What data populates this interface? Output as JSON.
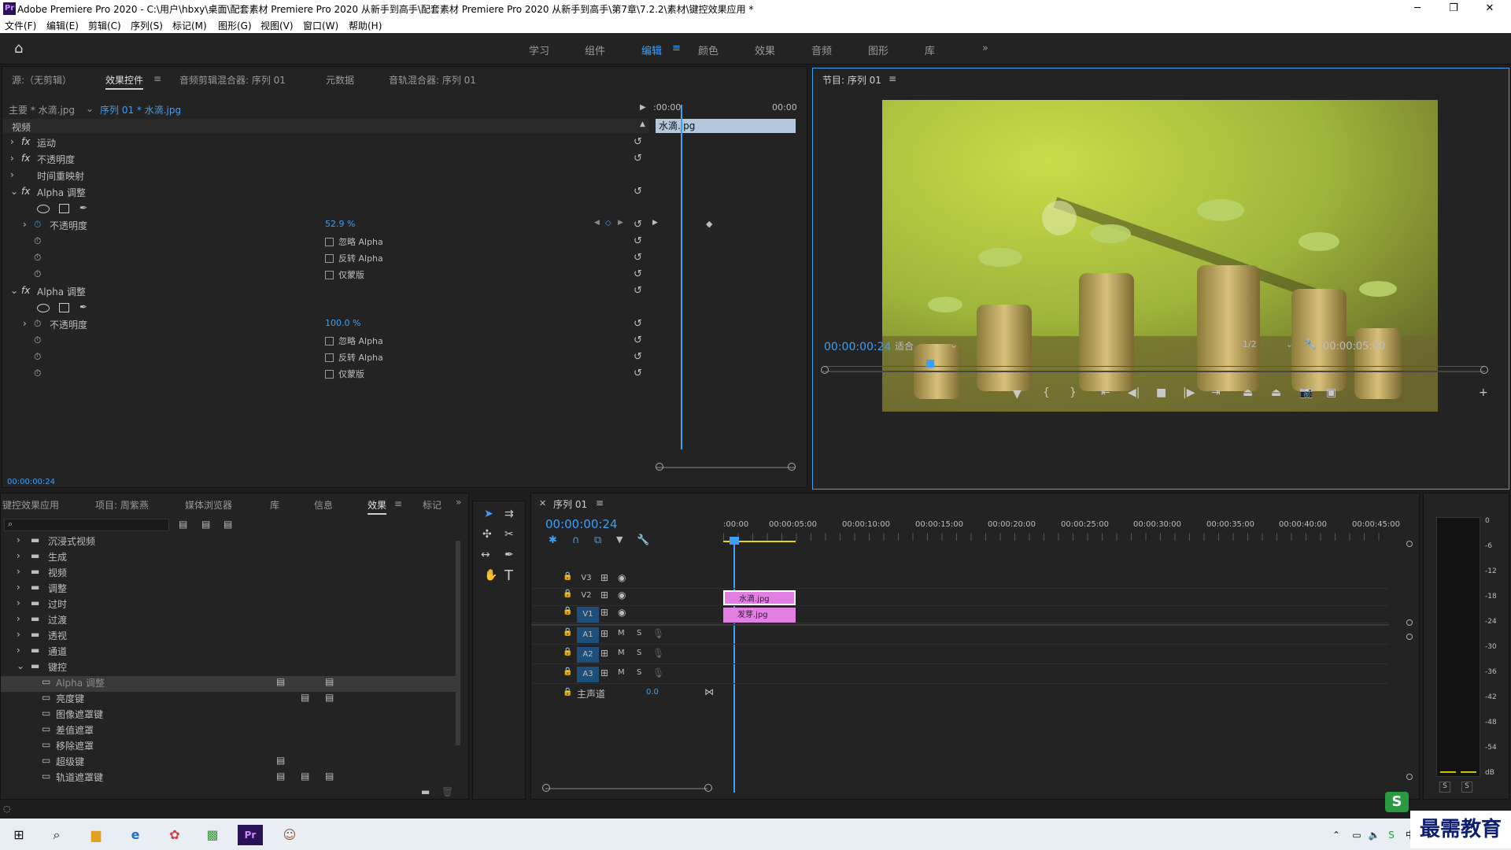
{
  "titlebar": {
    "title": "Adobe Premiere Pro 2020 - C:\\用户\\hbxy\\桌面\\配套素材 Premiere Pro 2020 从新手到高手\\配套素材 Premiere Pro 2020 从新手到高手\\第7章\\7.2.2\\素材\\键控效果应用 *",
    "minimize": "─",
    "maximize": "❐",
    "close": "✕"
  },
  "menu": [
    "文件(F)",
    "编辑(E)",
    "剪辑(C)",
    "序列(S)",
    "标记(M)",
    "图形(G)",
    "视图(V)",
    "窗口(W)",
    "帮助(H)"
  ],
  "workspaces": [
    "学习",
    "组件",
    "编辑",
    "颜色",
    "效果",
    "音频",
    "图形",
    "库"
  ],
  "workspace_more": "»",
  "effect_controls": {
    "tabs": [
      "源:（无剪辑）",
      "效果控件",
      "音频剪辑混合器: 序列 01",
      "元数据",
      "音轨混合器: 序列 01"
    ],
    "master": "主要 * 水滴.jpg",
    "sequence": "序列 01 * 水滴.jpg",
    "time_start": ":00:00",
    "time_end": "00:00",
    "clip_name": "水滴.jpg",
    "section": "视频",
    "items": [
      {
        "label": "运动",
        "fx": "fx"
      },
      {
        "label": "不透明度",
        "fx": "fx"
      },
      {
        "label": "时间重映射",
        "fx": ""
      },
      {
        "label": "Alpha 调整",
        "fx": "fx"
      }
    ],
    "alpha1": {
      "opacity_label": "不透明度",
      "opacity_value": "52.9 %",
      "ignore": "忽略 Alpha",
      "invert": "反转 Alpha",
      "mask": "仅蒙版"
    },
    "alpha2": {
      "title": "Alpha 调整",
      "opacity_label": "不透明度",
      "opacity_value": "100.0 %",
      "ignore": "忽略 Alpha",
      "invert": "反转 Alpha",
      "mask": "仅蒙版"
    },
    "current_time": "00:00:00:24"
  },
  "program": {
    "title": "节目: 序列 01",
    "timecode": "00:00:00:24",
    "fit": "适合",
    "resolution": "1/2",
    "duration": "00:00:05:00"
  },
  "project": {
    "tabs": [
      "键控效果应用",
      "项目: 周紫燕",
      "媒体浏览器",
      "库",
      "信息",
      "效果",
      "标记"
    ],
    "folders": [
      "沉浸式视频",
      "生成",
      "视频",
      "调整",
      "过时",
      "过渡",
      "透视",
      "通道",
      "键控"
    ],
    "keying": [
      "Alpha 调整",
      "亮度键",
      "图像遮罩键",
      "差值遮罩",
      "移除遮罩",
      "超级键",
      "轨道遮罩键"
    ]
  },
  "timeline": {
    "title": "序列 01",
    "timecode": "00:00:00:24",
    "ruler": [
      ":00:00",
      "00:00:05:00",
      "00:00:10:00",
      "00:00:15:00",
      "00:00:20:00",
      "00:00:25:00",
      "00:00:30:00",
      "00:00:35:00",
      "00:00:40:00",
      "00:00:45:00"
    ],
    "video_tracks": [
      "V3",
      "V2",
      "V1"
    ],
    "audio_tracks": [
      "A1",
      "A2",
      "A3"
    ],
    "master": "主声道",
    "master_value": "0.0",
    "clip_v2": "水滴.jpg",
    "clip_v1": "发芽.jpg",
    "m": "M",
    "s": "S"
  },
  "meter": {
    "scale": [
      "0",
      "-6",
      "-12",
      "-18",
      "-24",
      "-30",
      "-36",
      "-42",
      "-48",
      "-54",
      "dB"
    ],
    "s": "S"
  },
  "watermark": "最需教育",
  "colors": {
    "accent": "#3e9ff5",
    "clip": "#e27fe3",
    "panel": "#232323"
  }
}
